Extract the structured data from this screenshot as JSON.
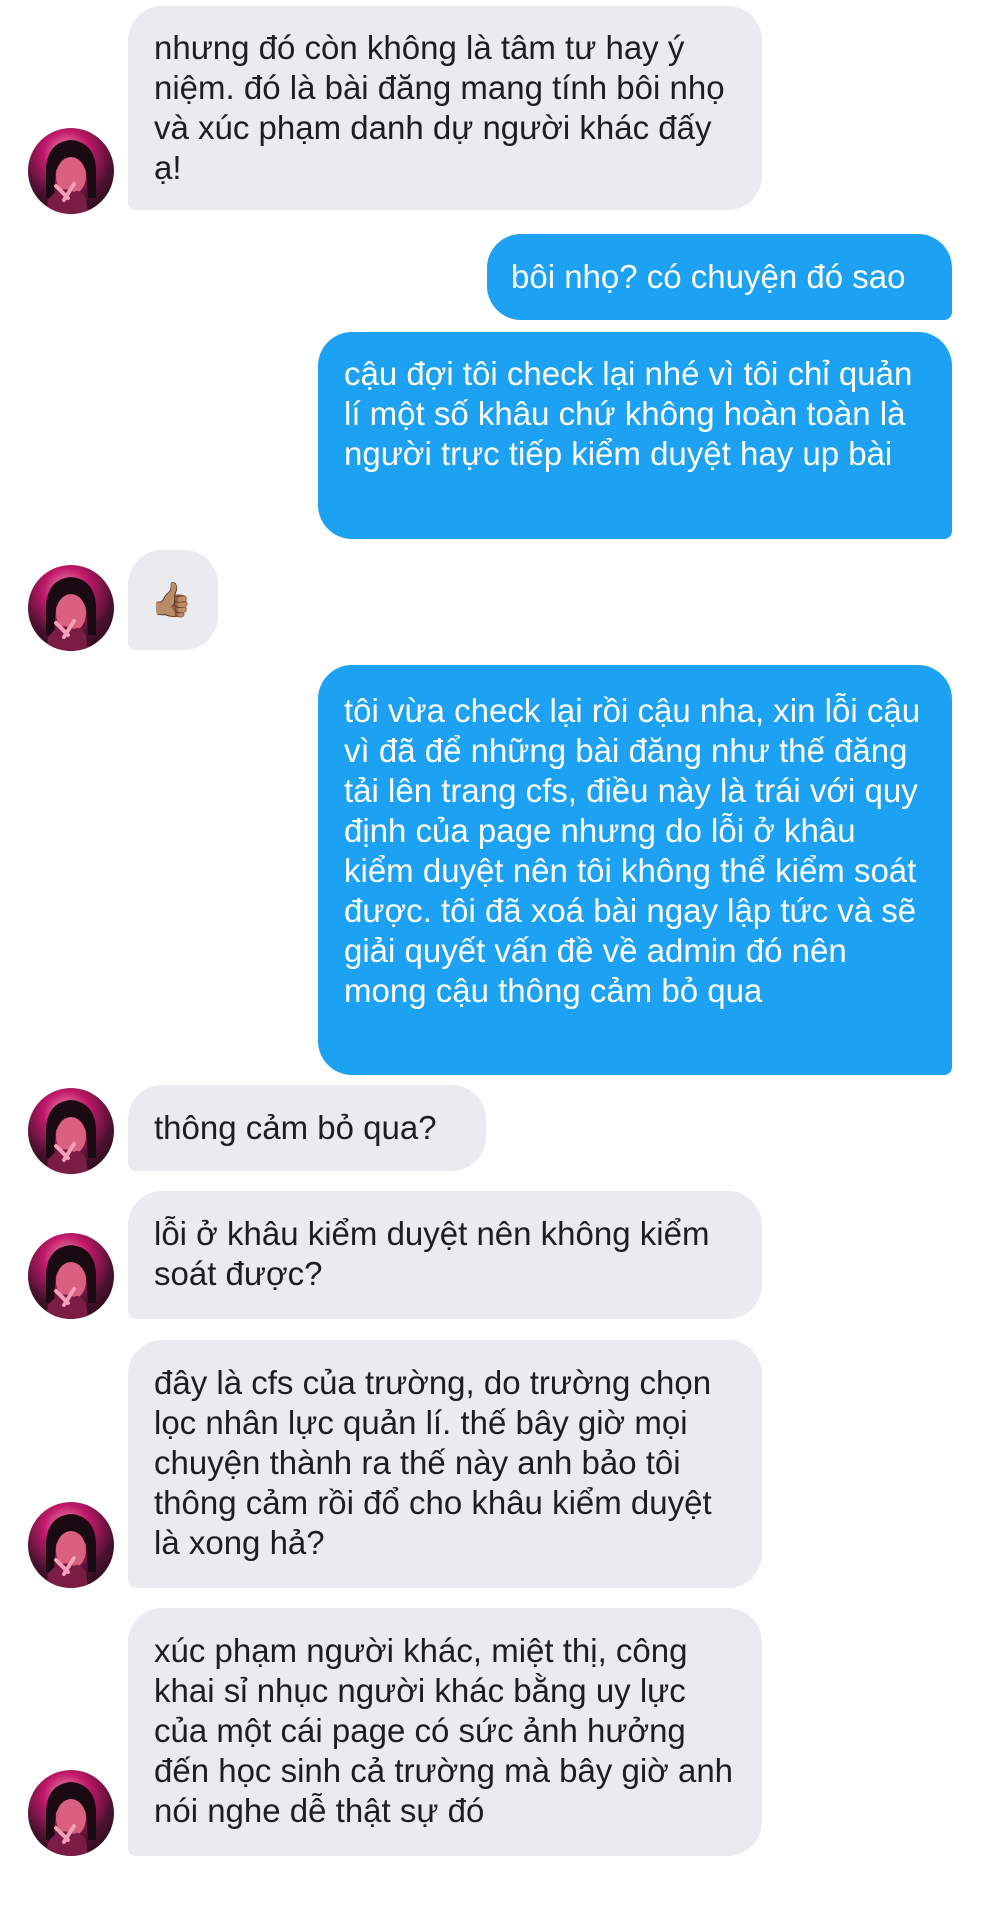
{
  "contact_avatar_alt": "contact-avatar",
  "messages": [
    {
      "side": "in",
      "text": "nhưng đó còn không là tâm tư hay ý niệm. đó là bài đăng mang tính bôi nhọ và xúc phạm danh dự người khác đấy ạ!"
    },
    {
      "side": "out",
      "text": "bôi nhọ? có chuyện đó sao"
    },
    {
      "side": "out",
      "text": "cậu đợi tôi check lại nhé vì tôi chỉ quản lí một số khâu chứ không hoàn toàn là người trực tiếp kiểm duyệt hay up bài"
    },
    {
      "side": "in",
      "text": "👍🏽",
      "emoji": "thumbs-up-icon"
    },
    {
      "side": "out",
      "text": "tôi vừa check lại rồi cậu nha, xin lỗi cậu vì đã để những bài đăng như thế đăng tải lên trang cfs, điều này là trái với quy định của page nhưng do lỗi ở khâu kiểm duyệt nên tôi không thể kiểm soát được. tôi đã xoá bài ngay lập tức và sẽ giải quyết vấn đề về admin đó nên mong cậu thông cảm bỏ qua"
    },
    {
      "side": "in",
      "text": "thông cảm bỏ qua?"
    },
    {
      "side": "in",
      "text": "lỗi ở khâu kiểm duyệt nên không kiểm soát được?"
    },
    {
      "side": "in",
      "text": "đây là cfs của trường, do trường chọn lọc nhân lực quản lí. thế bây giờ mọi chuyện thành ra thế này anh bảo tôi thông cảm rồi đổ cho khâu kiểm duyệt là xong hả?"
    },
    {
      "side": "in",
      "text": "xúc phạm người khác, miệt thị, công khai sỉ nhục người khác bằng uy lực của một cái page có sức ảnh hưởng đến học sinh cả trường mà bây giờ anh nói nghe dễ thật sự đó"
    }
  ],
  "colors": {
    "incoming_bubble": "#e9ebee",
    "outgoing_bubble": "#1da1f2",
    "incoming_text": "#1c1e21",
    "outgoing_text": "#ffffff"
  }
}
